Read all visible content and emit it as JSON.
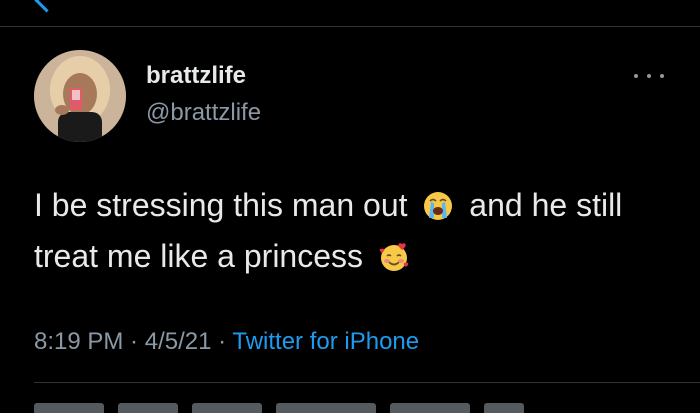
{
  "header": {
    "back_icon": "chevron-left-icon"
  },
  "tweet": {
    "display_name": "brattzlife",
    "handle": "@brattzlife",
    "more_icon": "more-horizontal-icon",
    "text_part1": "I be stressing this man out ",
    "text_emoji1": "loudly-crying-face-icon",
    "text_part2": " and he still treat me like a princess ",
    "text_emoji2": "smiling-face-with-hearts-icon",
    "time": "8:19 PM",
    "separator": " · ",
    "date": "4/5/21",
    "source": "Twitter for iPhone"
  },
  "colors": {
    "background": "#000000",
    "text": "#e7e9ea",
    "muted": "#8b98a5",
    "accent": "#1d9bf0",
    "divider": "#2f3336"
  }
}
